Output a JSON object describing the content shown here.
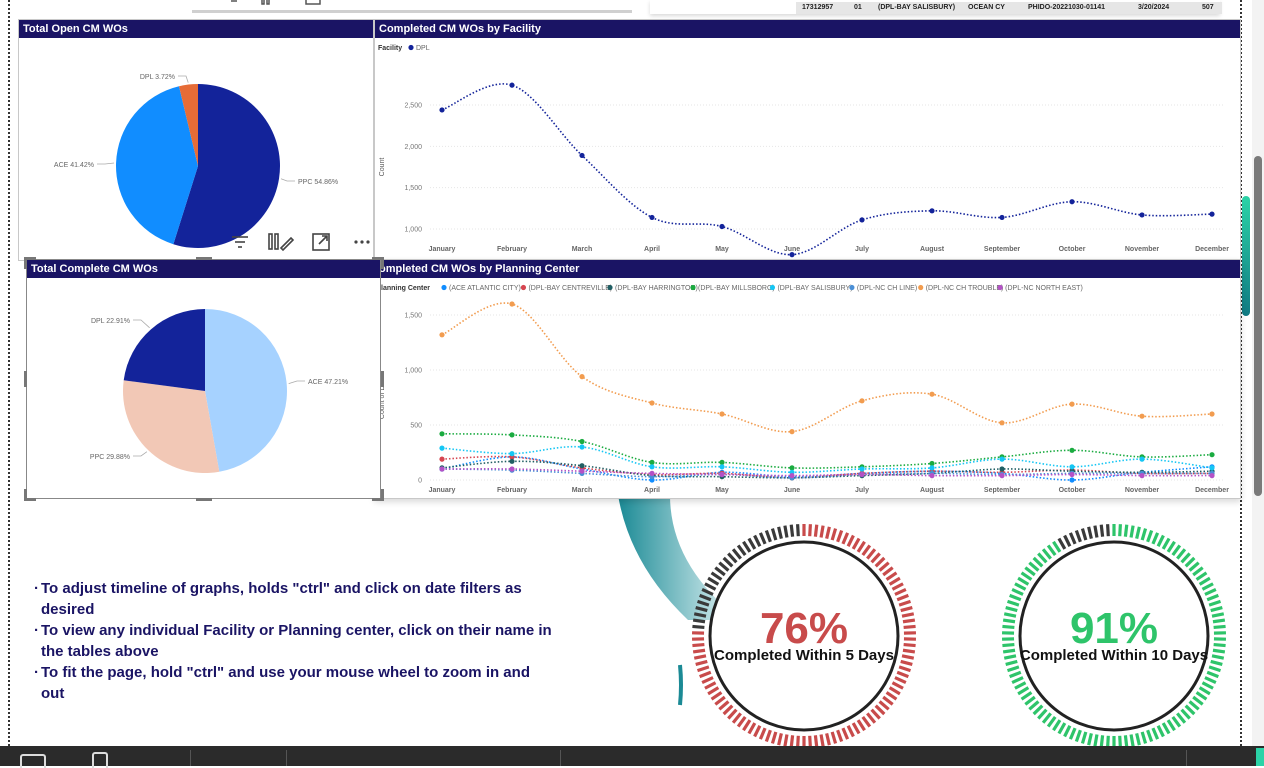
{
  "top_table_row": [
    "17312957",
    "01",
    "(DPL-BAY SALISBURY)",
    "OCEAN CY",
    "PHIDO-20221030-01141",
    "3/20/2024",
    "507"
  ],
  "pie_open": {
    "title": "Total Open CM WOs",
    "slices": [
      {
        "label": "PPC 54.86%",
        "value": 54.86,
        "color": "#13239a"
      },
      {
        "label": "ACE 41.42%",
        "value": 41.42,
        "color": "#118dff"
      },
      {
        "label": "DPL 3.72%",
        "value": 3.72,
        "color": "#e66c37"
      }
    ]
  },
  "pie_complete": {
    "title": "Total Complete CM WOs",
    "slices": [
      {
        "label": "ACE 47.21%",
        "value": 47.21,
        "color": "#a6d2ff"
      },
      {
        "label": "PPC 29.88%",
        "value": 29.88,
        "color": "#f2c8b6"
      },
      {
        "label": "DPL 22.91%",
        "value": 22.91,
        "color": "#13239a"
      }
    ]
  },
  "facility_chart": {
    "title": "Completed CM WOs by Facility",
    "legend_title": "Facility",
    "ylabel": "Count",
    "months": [
      "January",
      "February",
      "March",
      "April",
      "May",
      "June",
      "July",
      "August",
      "September",
      "October",
      "November",
      "December"
    ],
    "yticks": [
      "1,000",
      "1,500",
      "2,000",
      "2,500"
    ],
    "series": [
      {
        "name": "DPL",
        "color": "#13239a",
        "values": [
          2440,
          2740,
          1890,
          1140,
          1030,
          690,
          1110,
          1220,
          1140,
          1330,
          1170,
          1180
        ]
      }
    ]
  },
  "planning_chart": {
    "title": "ompleted CM WOs by Planning Center",
    "legend_title": "lanning Center",
    "ylabel": "Count of Date",
    "months": [
      "January",
      "February",
      "March",
      "April",
      "May",
      "June",
      "July",
      "August",
      "September",
      "October",
      "November",
      "December"
    ],
    "yticks": [
      "0",
      "500",
      "1,000",
      "1,500"
    ],
    "series": [
      {
        "name": "(ACE ATLANTIC CITY)",
        "color": "#118dff",
        "values": [
          100,
          210,
          100,
          0,
          70,
          30,
          60,
          80,
          60,
          0,
          70,
          120
        ]
      },
      {
        "name": "(DPL-BAY CENTREVILLE)",
        "color": "#d64550",
        "values": [
          190,
          210,
          110,
          50,
          60,
          20,
          60,
          80,
          70,
          90,
          60,
          60
        ]
      },
      {
        "name": "(DPL-BAY HARRINGTON)",
        "color": "#205e63",
        "values": [
          110,
          170,
          130,
          40,
          30,
          20,
          40,
          60,
          100,
          80,
          70,
          80
        ]
      },
      {
        "name": "(DPL-BAY MILLSBORO)",
        "color": "#1aab40",
        "values": [
          420,
          410,
          350,
          160,
          160,
          110,
          120,
          150,
          210,
          270,
          210,
          230
        ]
      },
      {
        "name": "(DPL-BAY SALISBURY)",
        "color": "#15c6f4",
        "values": [
          290,
          240,
          300,
          120,
          120,
          70,
          100,
          110,
          190,
          120,
          190,
          110
        ]
      },
      {
        "name": "(DPL-NC CH LINE)",
        "color": "#4a8fd6",
        "values": [
          100,
          90,
          60,
          30,
          50,
          20,
          50,
          60,
          50,
          60,
          60,
          60
        ]
      },
      {
        "name": "(DPL-NC CH TROUBLE)",
        "color": "#f29c4f",
        "values": [
          1320,
          1600,
          940,
          700,
          600,
          440,
          720,
          780,
          520,
          690,
          580,
          600
        ]
      },
      {
        "name": "(DPL-NC NORTH EAST)",
        "color": "#b452c6",
        "values": [
          100,
          100,
          80,
          60,
          50,
          40,
          50,
          40,
          40,
          50,
          40,
          40
        ]
      }
    ]
  },
  "instructions": [
    "To adjust timeline of graphs, holds \"ctrl\" and click on date filters as desired",
    "To view any individual Facility or Planning center, click on their name in the tables above",
    "To fit the page, hold \"ctrl\" and use your mouse wheel to zoom in and out"
  ],
  "gauge_5": {
    "value_text": "76%",
    "label": "Completed Within 5 Days",
    "fraction": 0.76,
    "color": "#c84b4b"
  },
  "gauge_10": {
    "value_text": "91%",
    "label": "Completed Within 10 Days",
    "fraction": 0.91,
    "color": "#2ec46a"
  },
  "icons": [
    "filter-icon",
    "focus-mode-icon",
    "expand-icon",
    "more-options-icon"
  ]
}
